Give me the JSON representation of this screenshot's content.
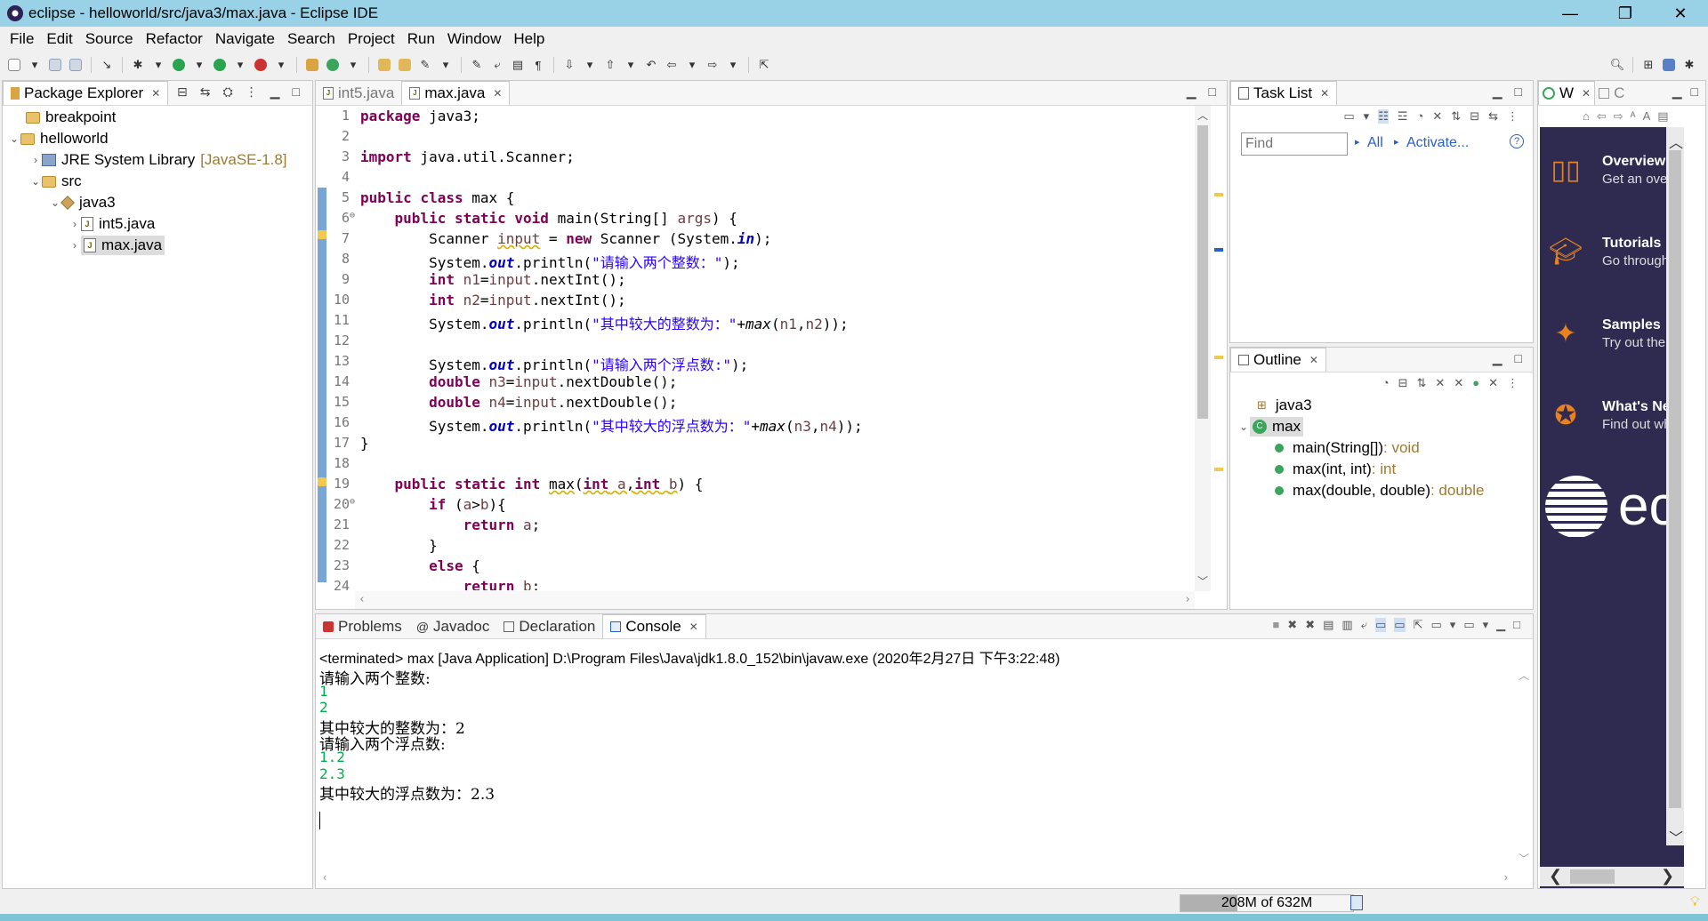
{
  "window": {
    "title": "eclipse - helloworld/src/java3/max.java - Eclipse IDE",
    "minimize": "—",
    "maximize": "❐",
    "close": "✕"
  },
  "menu": [
    "File",
    "Edit",
    "Source",
    "Refactor",
    "Navigate",
    "Search",
    "Project",
    "Run",
    "Window",
    "Help"
  ],
  "package_explorer": {
    "tab_label": "Package Explorer",
    "tree": [
      {
        "label": "breakpoint",
        "depth": 0,
        "arrow": "",
        "icon": "folder-icon"
      },
      {
        "label": "helloworld",
        "depth": 0,
        "arrow": "v",
        "icon": "folder-icon"
      },
      {
        "label": "JRE System Library",
        "extra": "[JavaSE-1.8]",
        "depth": 1,
        "arrow": ">",
        "icon": "library-icon"
      },
      {
        "label": "src",
        "depth": 1,
        "arrow": "v",
        "icon": "source-folder-icon"
      },
      {
        "label": "java3",
        "depth": 2,
        "arrow": "v",
        "icon": "package-icon"
      },
      {
        "label": "int5.java",
        "depth": 3,
        "arrow": ">",
        "icon": "java-file-icon"
      },
      {
        "label": "max.java",
        "depth": 3,
        "arrow": ">",
        "icon": "java-file-icon",
        "selected": true
      }
    ]
  },
  "editor": {
    "tabs": [
      {
        "label": "int5.java",
        "active": false
      },
      {
        "label": "max.java",
        "active": true
      }
    ],
    "line_numbers": [
      "1",
      "2",
      "3",
      "4",
      "5",
      "6",
      "7",
      "8",
      "9",
      "10",
      "11",
      "12",
      "13",
      "14",
      "15",
      "16",
      "17",
      "18",
      "19",
      "20",
      "21",
      "22",
      "23",
      "24"
    ]
  },
  "task_list": {
    "tab_label": "Task List",
    "find_placeholder": "Find",
    "all_label": "All",
    "activate_label": "Activate..."
  },
  "outline": {
    "tab_label": "Outline",
    "items": [
      {
        "label": "java3",
        "depth": 0
      },
      {
        "label": "max",
        "depth": 0
      },
      {
        "label": "main(String[])",
        "type": " : void",
        "depth": 1
      },
      {
        "label": "max(int, int)",
        "type": " : int",
        "depth": 1
      },
      {
        "label": "max(double, double)",
        "type": " : double",
        "depth": 1
      }
    ]
  },
  "welcome": {
    "tab_w": "W",
    "tab_c": "C",
    "items": [
      {
        "title": "Overview",
        "sub": "Get an overv"
      },
      {
        "title": "Tutorials",
        "sub": "Go through tu"
      },
      {
        "title": "Samples",
        "sub": "Try out the sa"
      },
      {
        "title": "What's New",
        "sub": "Find out wha"
      }
    ],
    "logo_text": "ec"
  },
  "bottom_panel": {
    "tabs": [
      {
        "label": "Problems",
        "active": false
      },
      {
        "label": "Javadoc",
        "active": false
      },
      {
        "label": "Declaration",
        "active": false
      },
      {
        "label": "Console",
        "active": true
      }
    ],
    "terminated": "<terminated> max [Java Application] D:\\Program Files\\Java\\jdk1.8.0_152\\bin\\javaw.exe (2020年2月27日 下午3:22:48)",
    "console_lines": [
      {
        "text": "请输入两个整数:",
        "kind": "out"
      },
      {
        "text": "1",
        "kind": "in"
      },
      {
        "text": "2",
        "kind": "in"
      },
      {
        "text": "其中较大的整数为：2",
        "kind": "out"
      },
      {
        "text": "请输入两个浮点数:",
        "kind": "out"
      },
      {
        "text": "1.2",
        "kind": "in"
      },
      {
        "text": "2.3",
        "kind": "in"
      },
      {
        "text": "其中较大的浮点数为：2.3",
        "kind": "out"
      }
    ]
  },
  "status": {
    "memory": "208M of 632M",
    "memory_fraction": 0.33
  },
  "colors": {
    "titlebar": "#99d1e6",
    "keyword": "#7f0055",
    "string": "#2a00ff",
    "field": "#0000c0",
    "console_input": "#00b050",
    "welcome_bg": "#2e2a50"
  }
}
